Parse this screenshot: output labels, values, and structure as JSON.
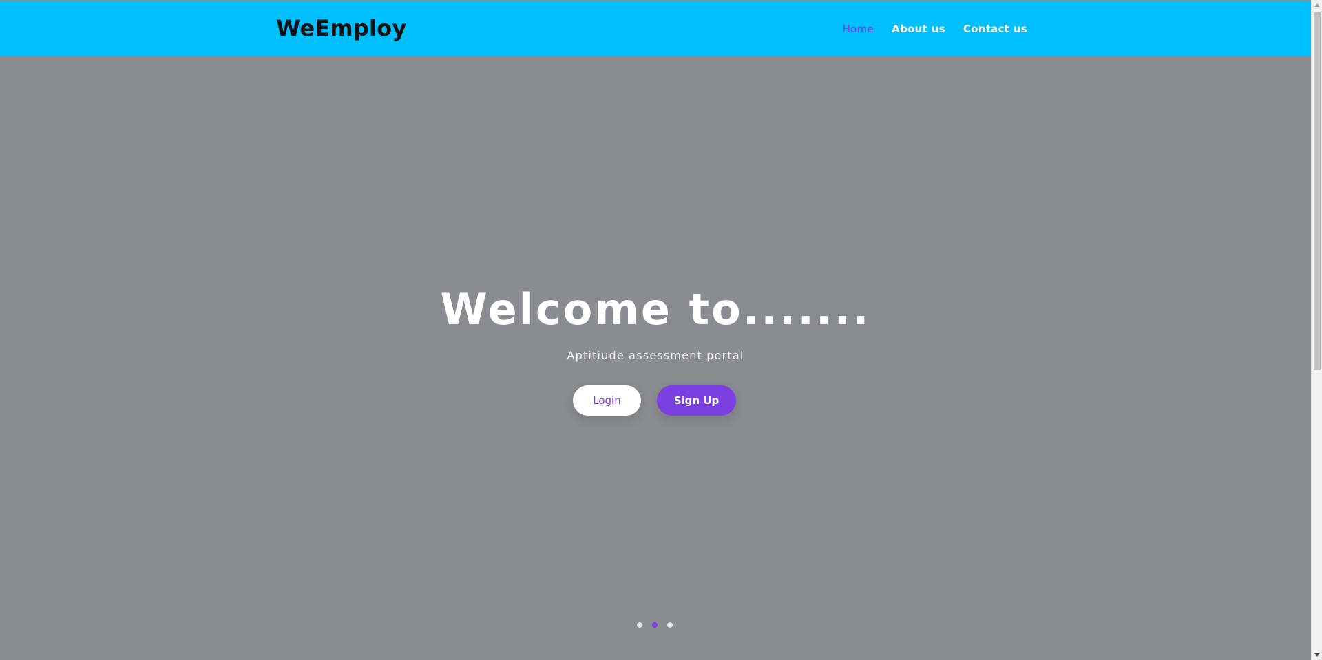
{
  "navbar": {
    "brand": "WeEmploy",
    "links": [
      {
        "label": "Home",
        "active": true
      },
      {
        "label": "About us",
        "active": false
      },
      {
        "label": "Contact us",
        "active": false
      }
    ],
    "background_color": "#00bfff"
  },
  "hero": {
    "title": "Welcome to.......",
    "subtitle": "Aptitiude assessment portal",
    "buttons": {
      "login_label": "Login",
      "signup_label": "Sign Up"
    },
    "background_color": "#8b8c90",
    "accent_color": "#7a3fe0"
  },
  "carousel": {
    "slide_count": 3,
    "active_index": 1
  }
}
